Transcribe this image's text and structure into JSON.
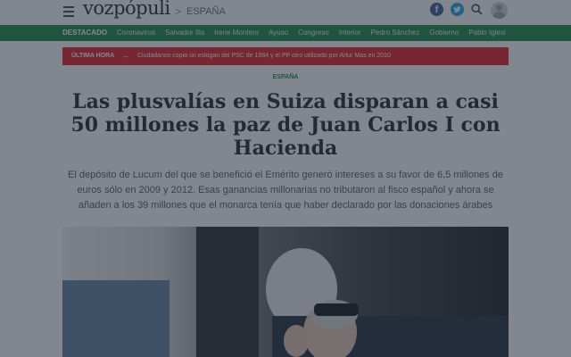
{
  "header": {
    "logo_text": "vozpópuli",
    "breadcrumb_sep": ">",
    "breadcrumb": "ESPAÑA",
    "facebook_glyph": "f"
  },
  "icons": [
    "menu-icon",
    "facebook-icon",
    "twitter-icon",
    "search-icon",
    "user-avatar-icon"
  ],
  "featured_nav": {
    "label": "DESTACADO",
    "items": [
      "Coronavirus",
      "Salvador Illa",
      "Irene Montero",
      "Ayuso",
      "Congreso",
      "Interior",
      "Pedro Sánchez",
      "Gobierno",
      "Pablo Iglesi"
    ]
  },
  "breaking": {
    "label": "ÚLTIMA HORA",
    "arrow": "→",
    "text": "Ciudadanos copia un eslogan del PSC de 1984 y el PP otro utilizado por Artur Mas en 2010"
  },
  "article": {
    "section": "ESPAÑA",
    "headline": "Las plusvalías en Suiza disparan a casi 50 millones la paz de Juan Carlos I con Hacienda",
    "lead": "El depósito de Lucum del que se benefició el Emérito generó intereses a su favor de 6,5 millones de euros sólo en 2009 y 2012. Esas ganancias millonarias no tributaron al fisco español y ahora se añaden a los 39 millones que el monarca tenía que haber declarado por las donaciones árabes"
  },
  "colors": {
    "featured_bar": "#14883e",
    "breaking_bar": "#e31b23",
    "facebook": "#3b5998",
    "twitter": "#1da1f2",
    "overlay": "rgba(40,48,62,0.58)"
  }
}
